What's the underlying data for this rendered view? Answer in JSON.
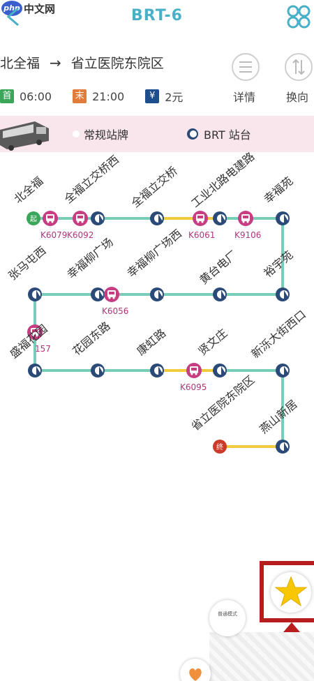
{
  "header": {
    "watermark_logo": "php",
    "watermark_text": "中文网",
    "title": "BRT-6"
  },
  "route": {
    "from": "北全福",
    "arrow": "→",
    "to": "省立医院东院区"
  },
  "actions": {
    "details_label": "详情",
    "reverse_label": "换向"
  },
  "info": {
    "first_tag": "首",
    "first_time": "06:00",
    "last_tag": "末",
    "last_time": "21:00",
    "fare_tag": "¥",
    "fare": "2元"
  },
  "legend": {
    "regular": "常规站牌",
    "brt": "BRT 站台"
  },
  "stations": {
    "s1": "北全福",
    "s2": "全福立交桥西",
    "s3": "全福立交桥",
    "s4": "工业北路电建路",
    "s5": "幸福苑",
    "s6": "裕宇苑",
    "s7": "黄台电厂",
    "s8": "幸福柳广场西",
    "s9": "幸福柳广场",
    "s10": "张马屯西",
    "s11": "盛福花园",
    "s12": "花园东路",
    "s13": "康虹路",
    "s14": "贤文庄",
    "s15": "新泺大街西口",
    "s16": "燕山新居",
    "s17": "省立医院东院区"
  },
  "markers": {
    "start": "起",
    "end": "终"
  },
  "buses": {
    "b1": "K6079",
    "b2": "K6092",
    "b3": "K6061",
    "b4": "K9106",
    "b5": "K6056",
    "b6": "157",
    "b7": "K6095"
  },
  "floating": {
    "mode_label": "普通模式"
  },
  "colors": {
    "accent": "#4ab0c8",
    "line_teal": "#78cdb8",
    "line_yellow": "#f0cc3c",
    "bus_marker": "#c73d82",
    "brt_icon": "#2b4a78",
    "start_green": "#3aa65a",
    "end_red": "#cc3b2a",
    "highlight_red": "#b81c1c"
  }
}
